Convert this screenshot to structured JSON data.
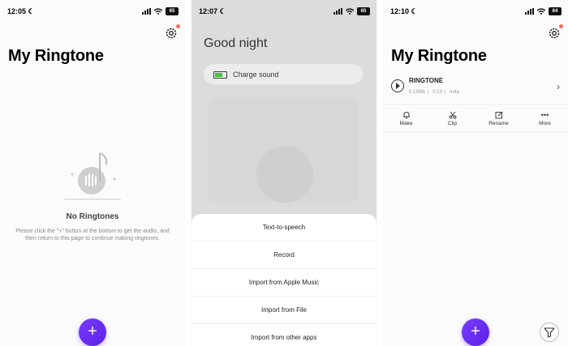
{
  "panel1": {
    "status_time": "12:05",
    "battery": "65",
    "title": "My Ringtone",
    "empty_title": "No Ringtones",
    "empty_desc": "Please click the \"+\" button at the bottom to get the audio, and then return to this page to continue making ringtones.",
    "add_label": "+"
  },
  "panel2": {
    "status_time": "12:07",
    "battery": "65",
    "greeting": "Good night",
    "charge_label": "Charge sound",
    "options": [
      "Text-to-speech",
      "Record",
      "Import from Apple Music",
      "Import from File",
      "Import from other apps"
    ]
  },
  "panel3": {
    "status_time": "12:10",
    "battery": "64",
    "title": "My Ringtone",
    "ringtone": {
      "name": "RINGTONE",
      "size": "0.15Mb",
      "duration": "0:19",
      "format": "m4a"
    },
    "actions": [
      "Make",
      "Clip",
      "Rename",
      "More"
    ],
    "add_label": "+"
  },
  "colors": {
    "accent": "#6a2ef2",
    "badge": "#ff6a4d",
    "battery_green": "#3ec63a"
  },
  "icons": [
    "moon-icon",
    "signal-icon",
    "wifi-icon",
    "battery-icon",
    "gear-icon",
    "play-icon",
    "chevron-right-icon",
    "bell-icon",
    "scissors-icon",
    "edit-icon",
    "more-icon",
    "filter-icon",
    "plus-icon"
  ]
}
